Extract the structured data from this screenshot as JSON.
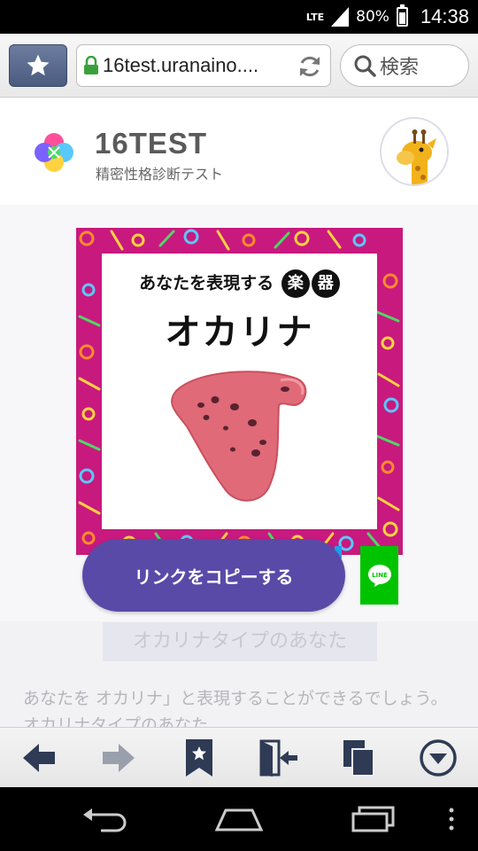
{
  "status_bar": {
    "network": "LTE",
    "battery_percent": "80%",
    "battery_level": 0.8,
    "time": "14:38"
  },
  "browser": {
    "bookmark_icon": "star-icon",
    "url": "16test.uranaino....",
    "search_placeholder": "検索",
    "reload_icon": "reload-icon"
  },
  "site": {
    "brand": "16TEST",
    "tagline": "精密性格診断テスト"
  },
  "result_card": {
    "subtitle": "あなたを表現する",
    "badge_1": "楽",
    "badge_2": "器",
    "title": "オカリナ",
    "image": "ocarina-illustration",
    "colors": {
      "frame": "#c8197f",
      "instrument": "#e06a78"
    }
  },
  "content": {
    "type_heading": "オカリナタイプのあなた",
    "description": "あなたを  オカリナ」と表現することができるでしょう。オカリナタイプのあなた"
  },
  "actions": {
    "copy_link_label": "リンクをコピーする",
    "line_label": "LINE",
    "colors": {
      "copy": "#5a4aa8",
      "line": "#00c300"
    }
  },
  "browser_nav": {
    "items": [
      "back-icon",
      "forward-icon",
      "bookmarks-icon",
      "exit-icon",
      "tabs-icon",
      "menu-icon"
    ]
  },
  "system_nav": {
    "items": [
      "back-icon",
      "home-icon",
      "recents-icon",
      "more-icon"
    ]
  }
}
